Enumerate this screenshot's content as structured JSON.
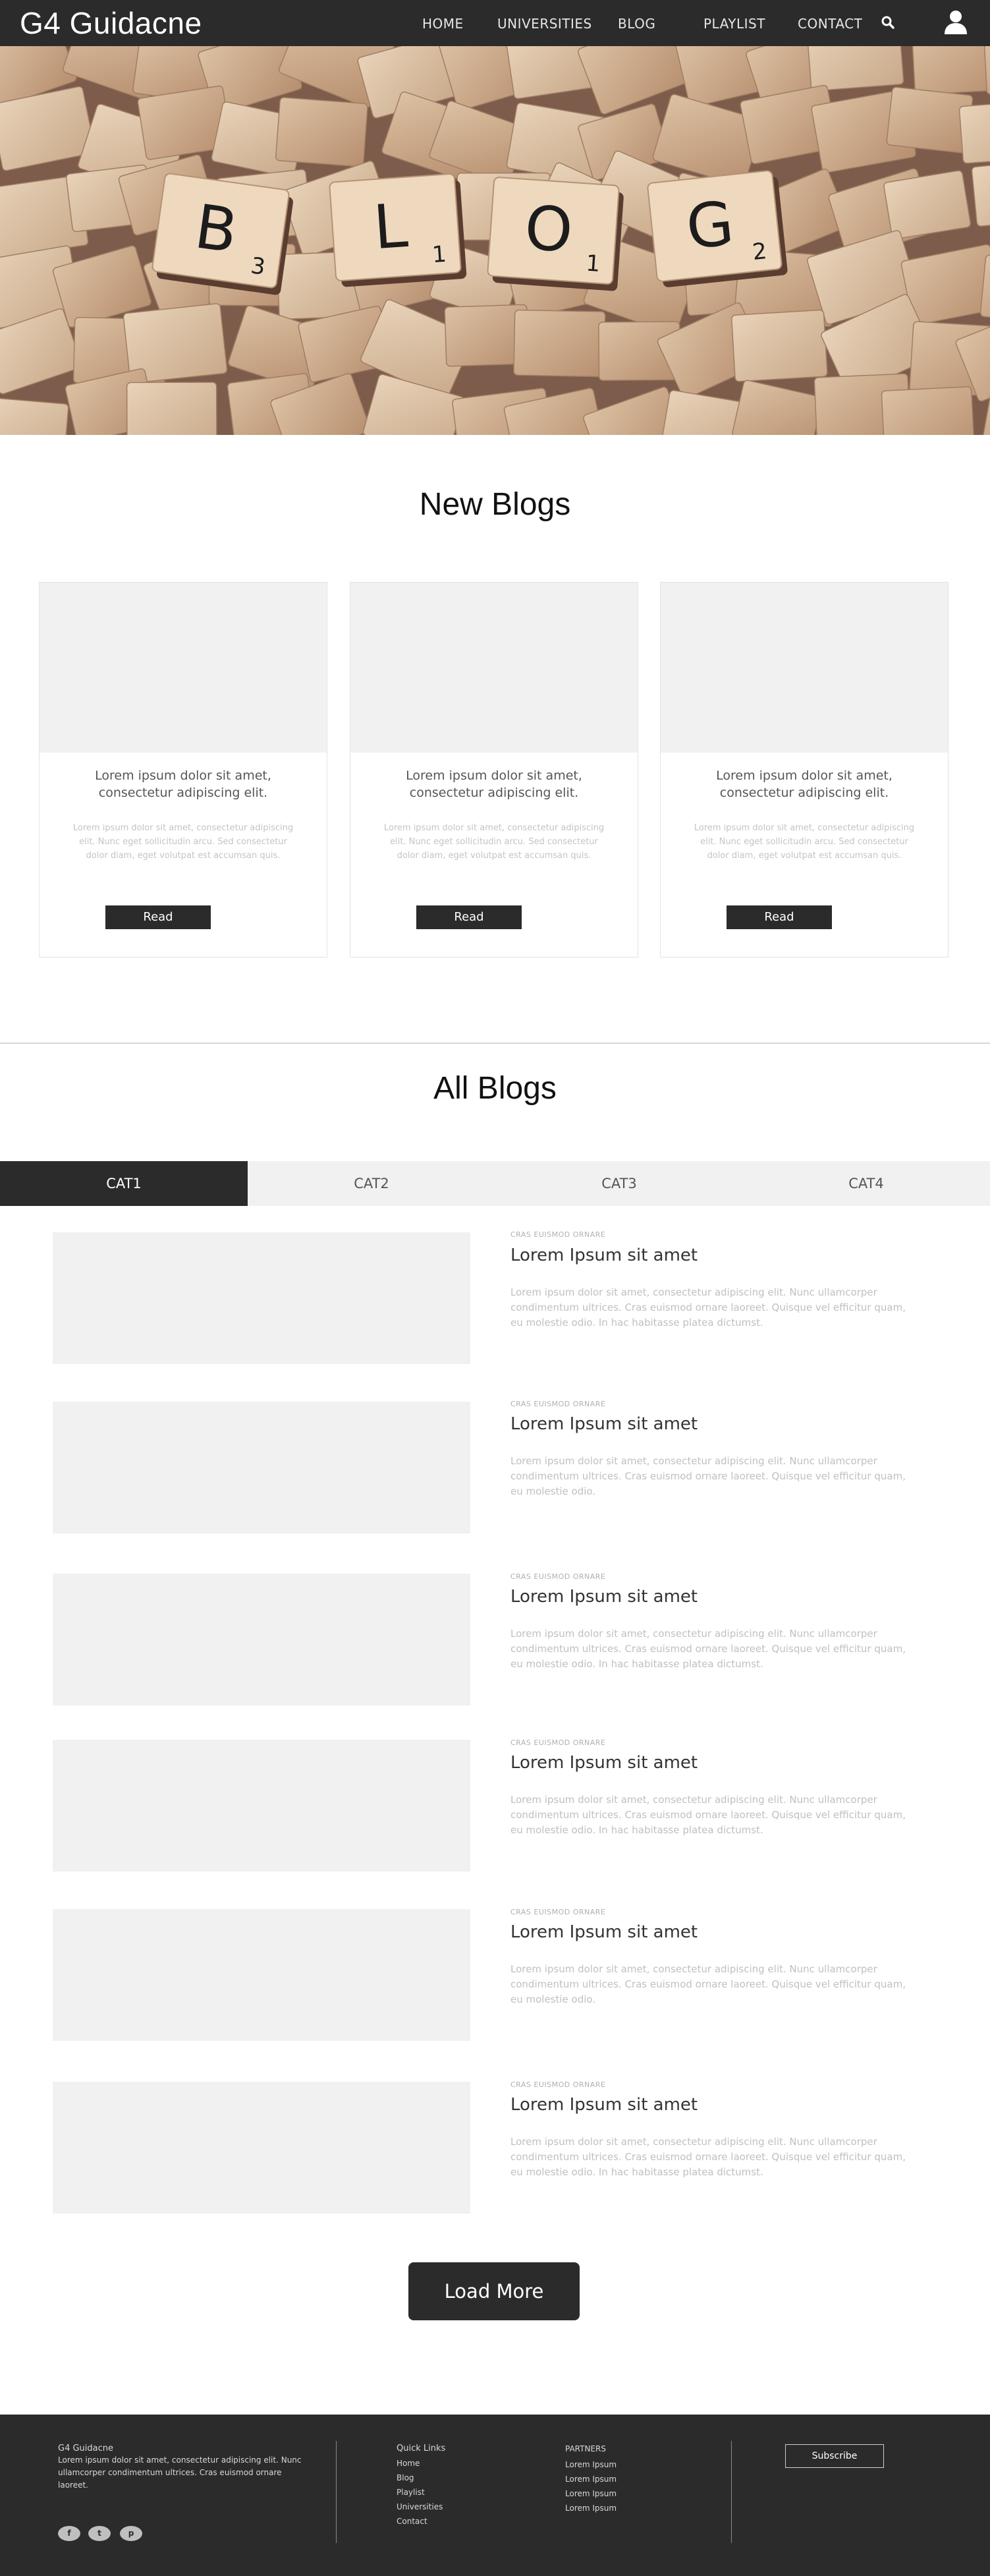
{
  "nav": {
    "brand": "G4 Guidacne",
    "links": [
      "HOME",
      "UNIVERSITIES",
      "BLOG",
      "PLAYLIST",
      "CONTACT"
    ]
  },
  "hero": {
    "tiles": [
      {
        "letter": "B",
        "number": "3"
      },
      {
        "letter": "L",
        "number": "1"
      },
      {
        "letter": "O",
        "number": "1"
      },
      {
        "letter": "G",
        "number": "2"
      }
    ]
  },
  "new_blogs": {
    "heading": "New Blogs",
    "cards": [
      {
        "title": "Lorem ipsum dolor sit amet, consectetur adipiscing elit.",
        "text": "Lorem ipsum dolor sit amet, consectetur adipiscing elit. Nunc eget sollicitudin arcu. Sed consectetur dolor diam, eget volutpat est accumsan quis.",
        "button": "Read"
      },
      {
        "title": "Lorem ipsum dolor sit amet, consectetur adipiscing elit.",
        "text": "Lorem ipsum dolor sit amet, consectetur adipiscing elit. Nunc eget sollicitudin arcu. Sed consectetur dolor diam, eget volutpat est accumsan quis.",
        "button": "Read"
      },
      {
        "title": "Lorem ipsum dolor sit amet, consectetur adipiscing elit.",
        "text": "Lorem ipsum dolor sit amet, consectetur adipiscing elit. Nunc eget sollicitudin arcu. Sed consectetur dolor diam, eget volutpat est accumsan quis.",
        "button": "Read"
      }
    ]
  },
  "all_blogs": {
    "heading": "All Blogs",
    "tabs": [
      "CAT1",
      "CAT2",
      "CAT3",
      "CAT4"
    ],
    "active_tab": "CAT1",
    "posts": [
      {
        "category": "CRAS EUISMOD ORNARE",
        "title": "Lorem Ipsum sit amet",
        "text": "Lorem ipsum dolor sit amet, consectetur adipiscing elit. Nunc ullamcorper condimentum ultrices. Cras euismod ornare laoreet. Quisque vel efficitur quam, eu molestie odio. In hac habitasse platea dictumst."
      },
      {
        "category": "CRAS EUISMOD ORNARE",
        "title": "Lorem Ipsum sit amet",
        "text": "Lorem ipsum dolor sit amet, consectetur adipiscing elit. Nunc ullamcorper condimentum ultrices. Cras euismod ornare laoreet. Quisque vel efficitur quam, eu molestie odio."
      },
      {
        "category": "CRAS EUISMOD ORNARE",
        "title": "Lorem Ipsum sit amet",
        "text": "Lorem ipsum dolor sit amet, consectetur adipiscing elit. Nunc ullamcorper condimentum ultrices. Cras euismod ornare laoreet. Quisque vel efficitur quam, eu molestie odio. In hac habitasse platea dictumst."
      },
      {
        "category": "CRAS EUISMOD ORNARE",
        "title": "Lorem Ipsum sit amet",
        "text": "Lorem ipsum dolor sit amet, consectetur adipiscing elit. Nunc ullamcorper condimentum ultrices. Cras euismod ornare laoreet. Quisque vel efficitur quam, eu molestie odio. In hac habitasse platea dictumst."
      },
      {
        "category": "CRAS EUISMOD ORNARE",
        "title": "Lorem Ipsum sit amet",
        "text": "Lorem ipsum dolor sit amet, consectetur adipiscing elit. Nunc ullamcorper condimentum ultrices. Cras euismod ornare laoreet. Quisque vel efficitur quam, eu molestie odio."
      },
      {
        "category": "CRAS EUISMOD ORNARE",
        "title": "Lorem Ipsum sit amet",
        "text": "Lorem ipsum dolor sit amet, consectetur adipiscing elit. Nunc ullamcorper condimentum ultrices. Cras euismod ornare laoreet. Quisque vel efficitur quam, eu molestie odio. In hac habitasse platea dictumst."
      }
    ],
    "load_more": "Load More"
  },
  "footer": {
    "about_title": "G4 Guidacne",
    "about_text": "Lorem ipsum dolor sit amet, consectetur adipiscing elit. Nunc ullamcorper condimentum ultrices. Cras euismod ornare laoreet.",
    "quick_links_title": "Quick Links",
    "quick_links": [
      "Home",
      "Blog",
      "Playlist",
      "Universities",
      "Contact"
    ],
    "partners_title": "PARTNERS",
    "partners": [
      "Lorem Ipsum",
      "Lorem Ipsum",
      "Lorem Ipsum",
      "Lorem Ipsum"
    ],
    "subscribe": "Subscribe",
    "social_icons": [
      "facebook-icon",
      "twitter-icon",
      "pinterest-icon"
    ],
    "social_glyphs": [
      "f",
      "t",
      "p"
    ]
  },
  "colors": {
    "dark": "#2b2b2b",
    "placeholder": "#f1f1f1",
    "muted_text": "#c0c0c0"
  }
}
